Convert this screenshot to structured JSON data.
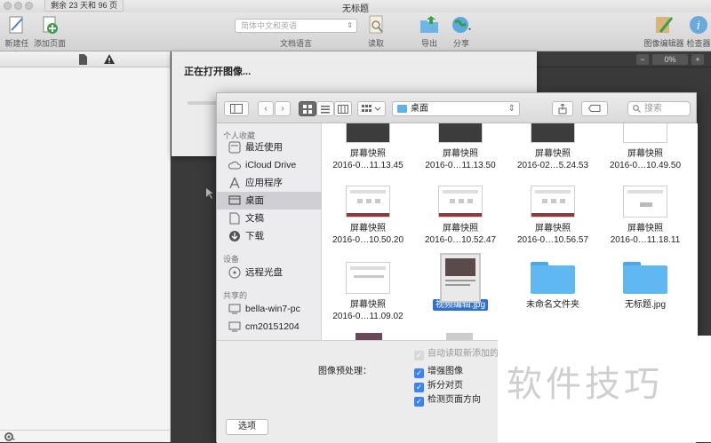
{
  "window": {
    "title": "无标题",
    "pages_left": "剩余 23 天和 96 页"
  },
  "toolbar": {
    "new_task": "新建任务",
    "add_page": "添加页面",
    "lang_select_value": "简体中文和英语",
    "lang_caption": "文档语言",
    "read": "读取",
    "export": "导出",
    "share": "分享",
    "image_editor": "图像编辑器",
    "inspector": "检查器"
  },
  "canvas": {
    "zoom": "0%",
    "minus": "−",
    "plus": "+"
  },
  "progress_sheet": {
    "title": "正在打开图像..."
  },
  "dialog": {
    "location": "桌面",
    "search_placeholder": "搜索",
    "sidebar": {
      "favorites_header": "个人收藏",
      "favorites": [
        "最近使用",
        "iCloud Drive",
        "应用程序",
        "桌面",
        "文稿",
        "下载"
      ],
      "devices_header": "设备",
      "devices": [
        "远程光盘"
      ],
      "shared_header": "共享的",
      "shared": [
        "bella-win7-pc",
        "cm20151204"
      ]
    },
    "files": [
      {
        "name": "屏幕快照",
        "date": "2016-0…11.13.45"
      },
      {
        "name": "屏幕快照",
        "date": "2016-0…11.13.50"
      },
      {
        "name": "屏幕快照",
        "date": "2016-02…5.24.53"
      },
      {
        "name": "屏幕快照",
        "date": "2016-0…10.49.50"
      },
      {
        "name": "屏幕快照",
        "date": "2016-0…10.50.20"
      },
      {
        "name": "屏幕快照",
        "date": "2016-0…10.52.47"
      },
      {
        "name": "屏幕快照",
        "date": "2016-0…10.56.57"
      },
      {
        "name": "屏幕快照",
        "date": "2016-0…11.18.11"
      },
      {
        "name": "屏幕快照",
        "date": "2016-0…11.09.02"
      },
      {
        "name": "视频编辑.jpg",
        "date": ""
      },
      {
        "name": "未命名文件夹",
        "date": ""
      },
      {
        "name": "无标题.jpg",
        "date": ""
      }
    ],
    "options": {
      "auto_read": "自动读取新添加的",
      "preprocess_label": "图像预处理：",
      "enhance": "增强图像",
      "split": "拆分对页",
      "detect": "检测页面方向",
      "options_button": "选项"
    }
  },
  "watermark": "软件技巧"
}
